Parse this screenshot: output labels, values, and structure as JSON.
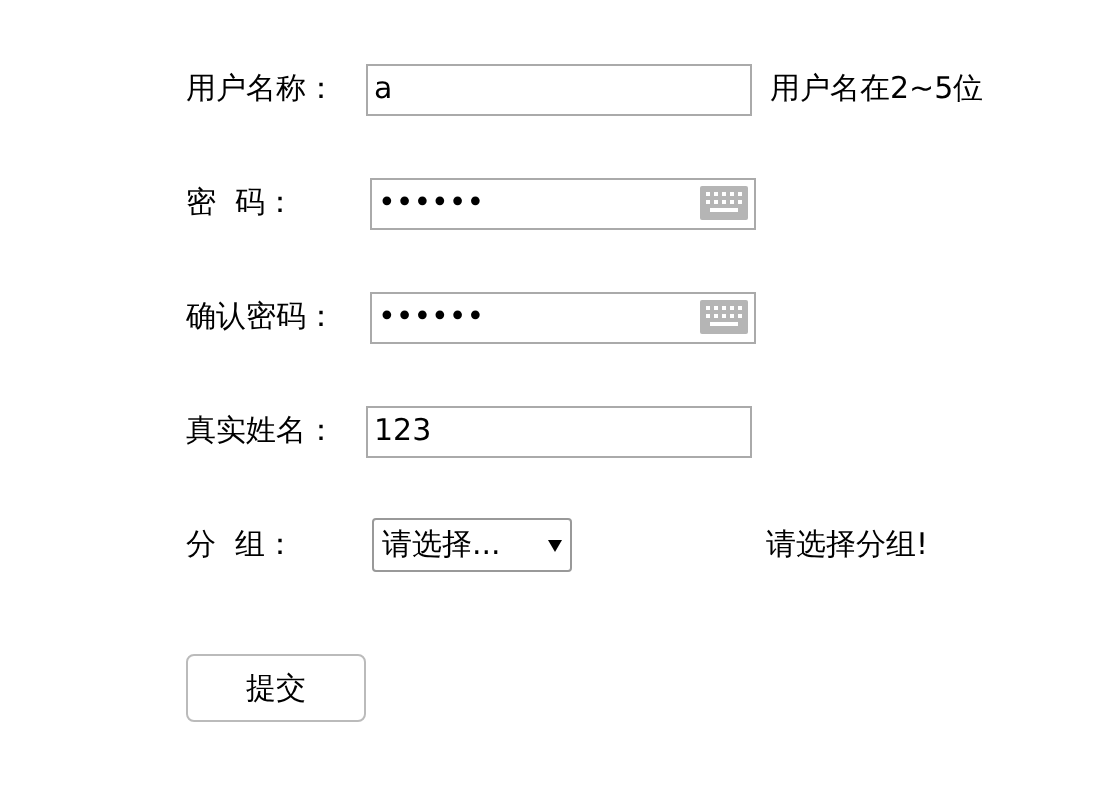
{
  "form": {
    "rows": [
      {
        "label": "用户名称：",
        "kind": "text",
        "value": "a",
        "hint": "用户名在2~5位"
      },
      {
        "label": "密  码：",
        "kind": "password",
        "value": "••••••"
      },
      {
        "label": "确认密码：",
        "kind": "password",
        "value": "••••••"
      },
      {
        "label": "真实姓名：",
        "kind": "text",
        "value": "123"
      },
      {
        "label": "分  组：",
        "kind": "select",
        "value": "请选择...",
        "hint": "请选择分组!"
      }
    ],
    "submit": "提交"
  }
}
